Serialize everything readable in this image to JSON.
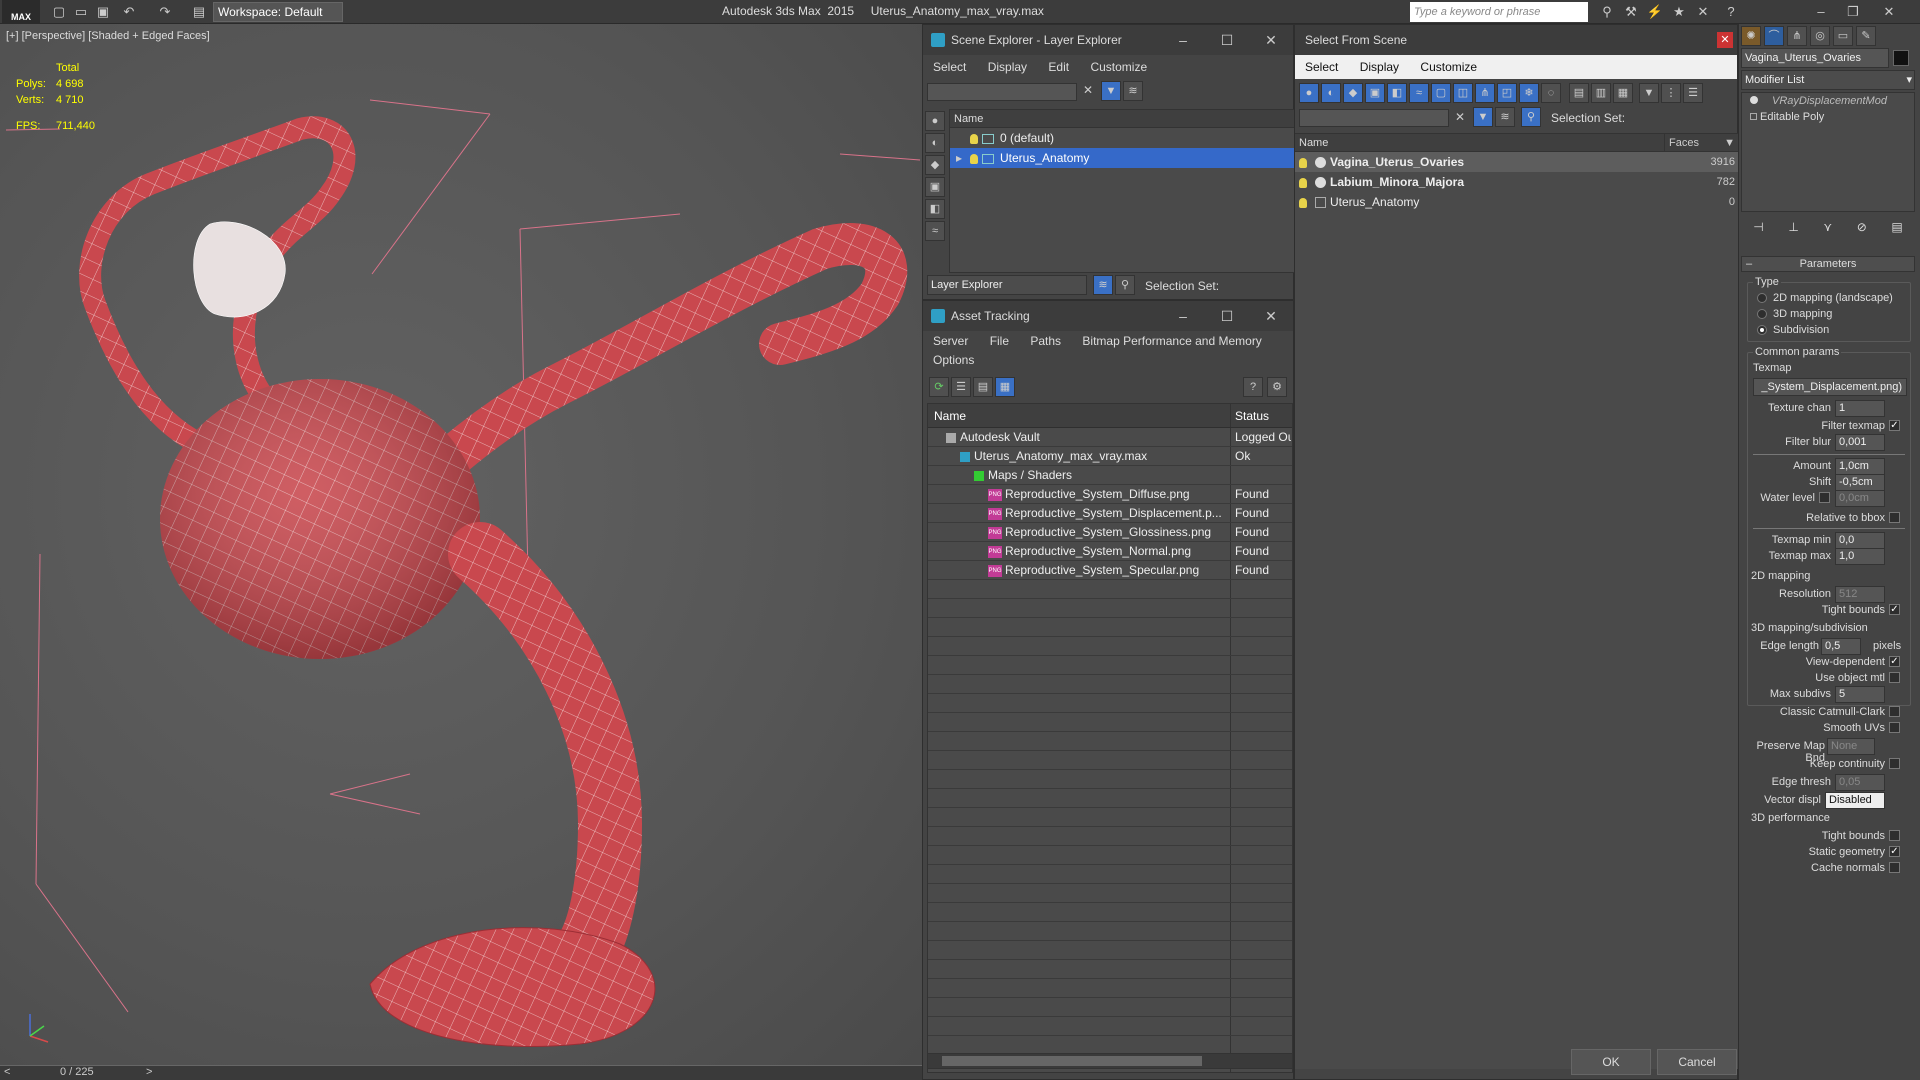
{
  "app": {
    "logo_text": "MAX",
    "title": "Autodesk 3ds Max  2015     Uterus_Anatomy_max_vray.max",
    "workspace": "Workspace: Default",
    "search_placeholder": "Type a keyword or phrase"
  },
  "viewport": {
    "label": "[+] [Perspective] [Shaded + Edged Faces]",
    "stats": {
      "header": "Total",
      "polys_label": "Polys:",
      "polys": "4 698",
      "verts_label": "Verts:",
      "verts": "4 710",
      "fps_label": "FPS:",
      "fps": "711,440"
    },
    "timeline": "0 / 225",
    "mesh_color": "#c9484e"
  },
  "scene_explorer": {
    "title": "Scene Explorer - Layer Explorer",
    "menu": [
      "Select",
      "Display",
      "Edit",
      "Customize"
    ],
    "column": "Name",
    "layers": [
      {
        "label": "0 (default)",
        "selected": false
      },
      {
        "label": "Uterus_Anatomy",
        "selected": true
      }
    ],
    "footer_dropdown": "Layer Explorer",
    "selection_set_label": "Selection Set:"
  },
  "asset_tracking": {
    "title": "Asset Tracking",
    "menu": [
      "Server",
      "File",
      "Paths",
      "Bitmap Performance and Memory"
    ],
    "menu2": "Options",
    "columns": {
      "name": "Name",
      "status": "Status"
    },
    "rows": [
      {
        "name": "Autodesk Vault",
        "status": "Logged Ou",
        "indent": 1
      },
      {
        "name": "Uterus_Anatomy_max_vray.max",
        "status": "Ok",
        "indent": 2
      },
      {
        "name": "Maps / Shaders",
        "status": "",
        "indent": 3
      },
      {
        "name": "Reproductive_System_Diffuse.png",
        "status": "Found",
        "indent": 4
      },
      {
        "name": "Reproductive_System_Displacement.p...",
        "status": "Found",
        "indent": 4
      },
      {
        "name": "Reproductive_System_Glossiness.png",
        "status": "Found",
        "indent": 4
      },
      {
        "name": "Reproductive_System_Normal.png",
        "status": "Found",
        "indent": 4
      },
      {
        "name": "Reproductive_System_Specular.png",
        "status": "Found",
        "indent": 4
      }
    ]
  },
  "select_from_scene": {
    "title": "Select From Scene",
    "menu": [
      "Select",
      "Display",
      "Customize"
    ],
    "selection_set_label": "Selection Set:",
    "columns": {
      "name": "Name",
      "faces": "Faces"
    },
    "rows": [
      {
        "name": "Vagina_Uterus_Ovaries",
        "faces": "3916",
        "bold": true,
        "highlight": true
      },
      {
        "name": "Labium_Minora_Majora",
        "faces": "782",
        "bold": true,
        "highlight": false
      },
      {
        "name": "Uterus_Anatomy",
        "faces": "0",
        "bold": false,
        "highlight": false
      }
    ],
    "ok": "OK",
    "cancel": "Cancel"
  },
  "modifier_panel": {
    "object_name": "Vagina_Uterus_Ovaries",
    "modifier_list": "Modifier List",
    "stack": [
      "VRayDisplacementMod",
      "Editable Poly"
    ],
    "rollout": "Parameters",
    "type_label": "Type",
    "type_options": [
      {
        "label": "2D mapping (landscape)",
        "checked": false
      },
      {
        "label": "3D mapping",
        "checked": false
      },
      {
        "label": "Subdivision",
        "checked": true
      }
    ],
    "common_params": "Common params",
    "texmap_label": "Texmap",
    "texmap_value": "_System_Displacement.png)",
    "texture_chan_label": "Texture chan",
    "texture_chan": "1",
    "filter_texmap_label": "Filter texmap",
    "filter_texmap": true,
    "filter_blur_label": "Filter blur",
    "filter_blur": "0,001",
    "amount_label": "Amount",
    "amount": "1,0cm",
    "shift_label": "Shift",
    "shift": "-0,5cm",
    "water_level_label": "Water level",
    "water_level": "0,0cm",
    "relative_bbox_label": "Relative to bbox",
    "texmap_min_label": "Texmap min",
    "texmap_min": "0,0",
    "texmap_max_label": "Texmap max",
    "texmap_max": "1,0",
    "mapping2d_label": "2D mapping",
    "resolution_label": "Resolution",
    "resolution": "512",
    "tight_bounds_label": "Tight bounds",
    "mapping3d_label": "3D mapping/subdivision",
    "edge_length_label": "Edge length",
    "edge_length": "0,5",
    "pixels_label": "pixels",
    "view_dependent_label": "View-dependent",
    "use_object_mtl_label": "Use object mtl",
    "max_subdivs_label": "Max subdivs",
    "max_subdivs": "5",
    "catmull_label": "Classic Catmull-Clark",
    "smooth_uvs_label": "Smooth UVs",
    "preserve_map_label": "Preserve Map Bnd",
    "preserve_map": "None",
    "keep_continuity_label": "Keep continuity",
    "edge_thresh_label": "Edge thresh",
    "edge_thresh": "0,05",
    "vector_displ_label": "Vector displ",
    "vector_displ": "Disabled",
    "perf_label": "3D performance",
    "perf_tight_label": "Tight bounds",
    "static_geom_label": "Static geometry",
    "cache_normals_label": "Cache normals"
  }
}
